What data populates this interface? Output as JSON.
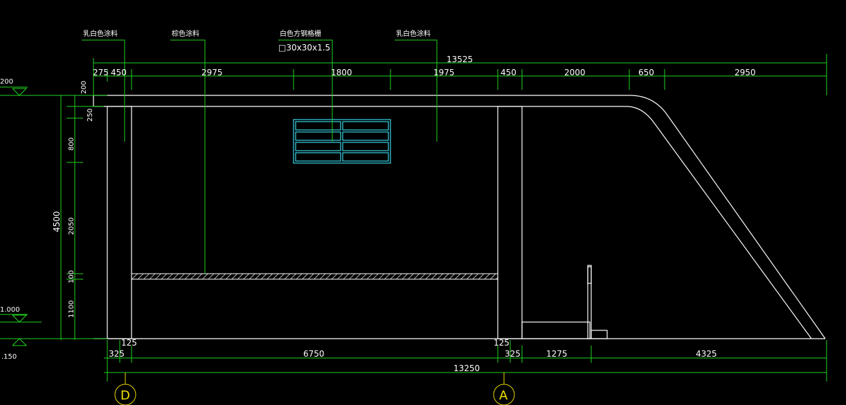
{
  "labels": {
    "material_1": "乳白色涂料",
    "material_2": "棕色涂料",
    "material_3": "白色方钢格栅",
    "material_3_spec": "□30x30x1.5",
    "material_4": "乳白色涂料"
  },
  "top_dims": {
    "overall": "13525",
    "segments": [
      "275",
      "450",
      "2975",
      "1800",
      "1975",
      "450",
      "2000",
      "650",
      "2950"
    ]
  },
  "bottom_dims": {
    "overall": "13250",
    "segments": [
      "325",
      "6750",
      "325",
      "1275",
      "4325"
    ],
    "col_offsets": [
      "125",
      "125"
    ]
  },
  "left_dims": {
    "overall": "4500",
    "segments": [
      "200",
      "250",
      "800",
      "2050",
      "100",
      "1100"
    ]
  },
  "levels": [
    "200",
    "1.000",
    ".150"
  ],
  "axes": [
    "D",
    "A"
  ],
  "colors": {
    "background": "#000000",
    "dimension": "#1fd41f",
    "outline": "#ffffff",
    "grille": "#38d7e8",
    "axis": "#e8d800"
  }
}
